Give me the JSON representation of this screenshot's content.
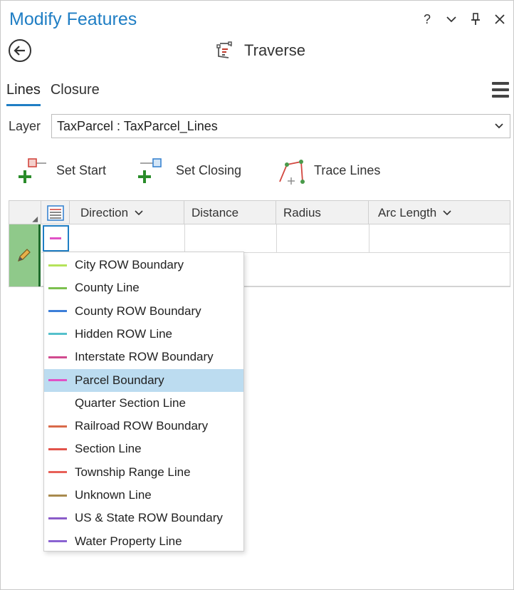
{
  "pane": {
    "title": "Modify Features",
    "help_label": "?",
    "tool_title": "Traverse"
  },
  "tabs": [
    {
      "label": "Lines",
      "active": true
    },
    {
      "label": "Closure",
      "active": false
    }
  ],
  "layer": {
    "label": "Layer",
    "value": "TaxParcel : TaxParcel_Lines"
  },
  "toolbar": {
    "set_start": "Set Start",
    "set_closing": "Set Closing",
    "trace_lines": "Trace Lines"
  },
  "grid": {
    "columns": [
      {
        "label": "Direction",
        "has_menu": true
      },
      {
        "label": "Distance",
        "has_menu": false
      },
      {
        "label": "Radius",
        "has_menu": false
      },
      {
        "label": "Arc Length",
        "has_menu": true
      }
    ]
  },
  "line_types": [
    {
      "label": "City ROW Boundary",
      "color": "#b5e35a",
      "selected": false
    },
    {
      "label": "County Line",
      "color": "#7cc04f",
      "selected": false
    },
    {
      "label": "County ROW Boundary",
      "color": "#3c7fd8",
      "selected": false
    },
    {
      "label": "Hidden ROW Line",
      "color": "#55c0cc",
      "selected": false
    },
    {
      "label": "Interstate ROW Boundary",
      "color": "#d14b8f",
      "selected": false
    },
    {
      "label": "Parcel Boundary",
      "color": "#e052c6",
      "selected": true
    },
    {
      "label": "Quarter Section Line",
      "color": "",
      "selected": false
    },
    {
      "label": "Railroad ROW Boundary",
      "color": "#d96a4a",
      "selected": false
    },
    {
      "label": "Section Line",
      "color": "#e2534b",
      "selected": false
    },
    {
      "label": "Township Range Line",
      "color": "#e86058",
      "selected": false
    },
    {
      "label": "Unknown Line",
      "color": "#a88a4e",
      "selected": false
    },
    {
      "label": "US & State ROW Boundary",
      "color": "#8b5cc9",
      "selected": false
    },
    {
      "label": "Water Property Line",
      "color": "#8a63d2",
      "selected": false
    }
  ]
}
